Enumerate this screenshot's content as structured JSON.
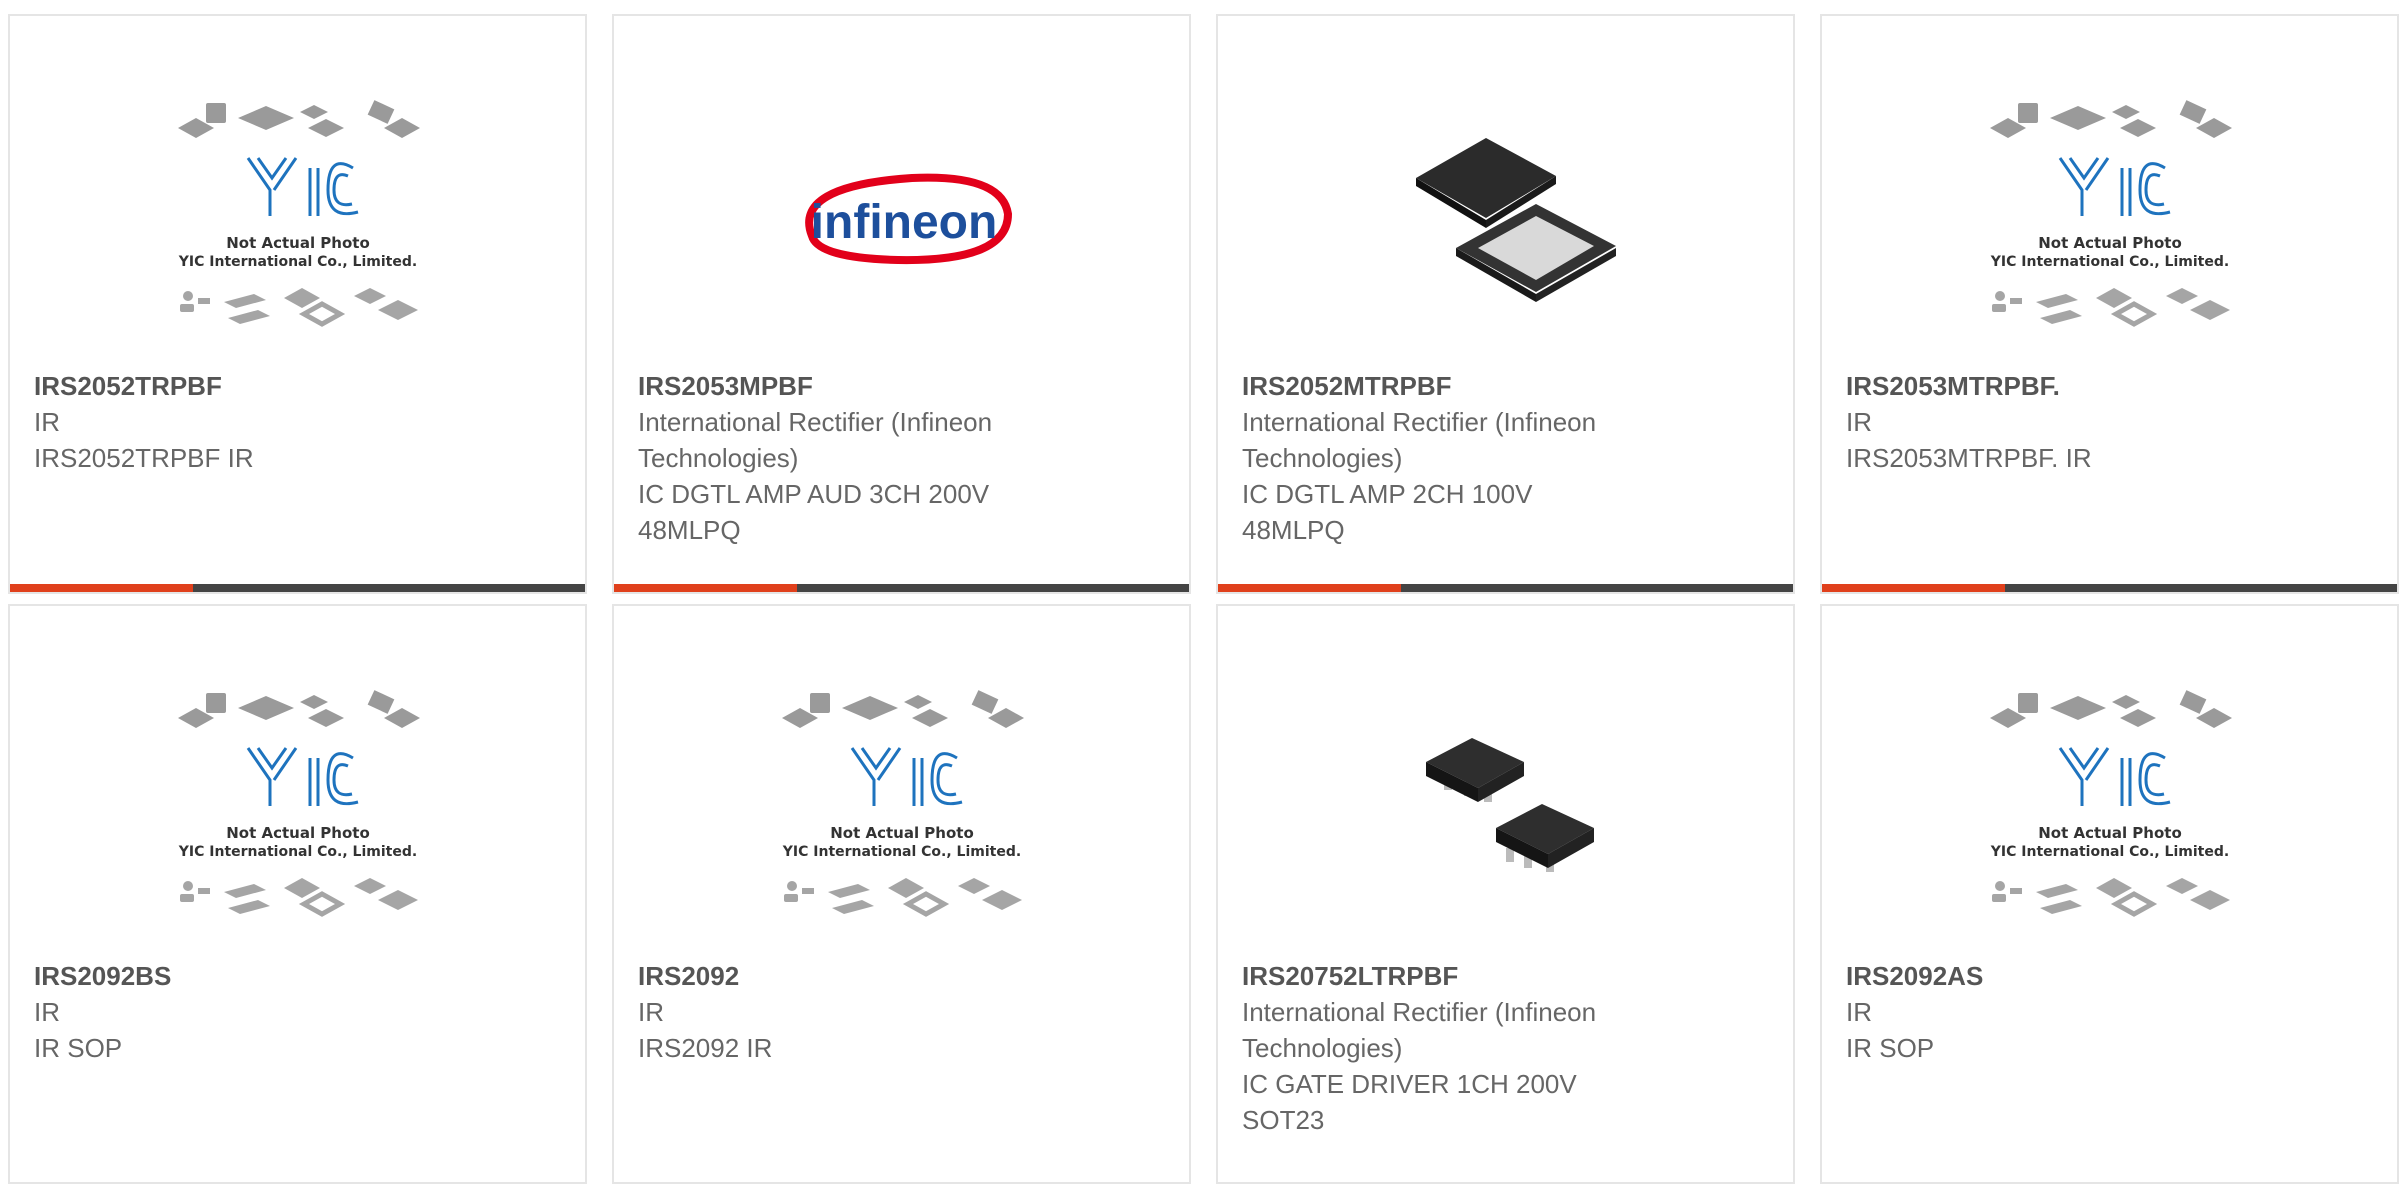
{
  "placeholder": {
    "brand_text": "YIC",
    "line1": "Not Actual Photo",
    "line2": "YIC International Co., Limited."
  },
  "colors": {
    "accent": "#e0401c",
    "bar": "#444444",
    "yic_blue": "#1e73be",
    "infineon_red": "#e2001a",
    "infineon_blue": "#1d4f9c"
  },
  "products": [
    {
      "part": "IRS2052TRPBF",
      "manufacturer": "IR",
      "desc1": "IRS2052TRPBF IR",
      "desc2": "",
      "image": "placeholder"
    },
    {
      "part": "IRS2053MPBF",
      "manufacturer": "International Rectifier (Infineon Technologies)",
      "desc1": "IC DGTL AMP AUD 3CH 200V",
      "desc2": "48MLPQ",
      "image": "infineon-logo",
      "logo_text": "infineon"
    },
    {
      "part": "IRS2052MTRPBF",
      "manufacturer": "International Rectifier (Infineon Technologies)",
      "desc1": "IC DGTL AMP 2CH 100V",
      "desc2": "48MLPQ",
      "image": "qfn-chip"
    },
    {
      "part": "IRS2053MTRPBF.",
      "manufacturer": "IR",
      "desc1": "IRS2053MTRPBF. IR",
      "desc2": "",
      "image": "placeholder"
    },
    {
      "part": "IRS2092BS",
      "manufacturer": "IR",
      "desc1": "IR SOP",
      "desc2": "",
      "image": "placeholder"
    },
    {
      "part": "IRS2092",
      "manufacturer": "IR",
      "desc1": "IRS2092 IR",
      "desc2": "",
      "image": "placeholder"
    },
    {
      "part": "IRS20752LTRPBF",
      "manufacturer": "International Rectifier (Infineon Technologies)",
      "desc1": "IC GATE DRIVER 1CH 200V",
      "desc2": "SOT23",
      "image": "sot23-chip"
    },
    {
      "part": "IRS2092AS",
      "manufacturer": "IR",
      "desc1": "IR SOP",
      "desc2": "",
      "image": "placeholder"
    }
  ]
}
